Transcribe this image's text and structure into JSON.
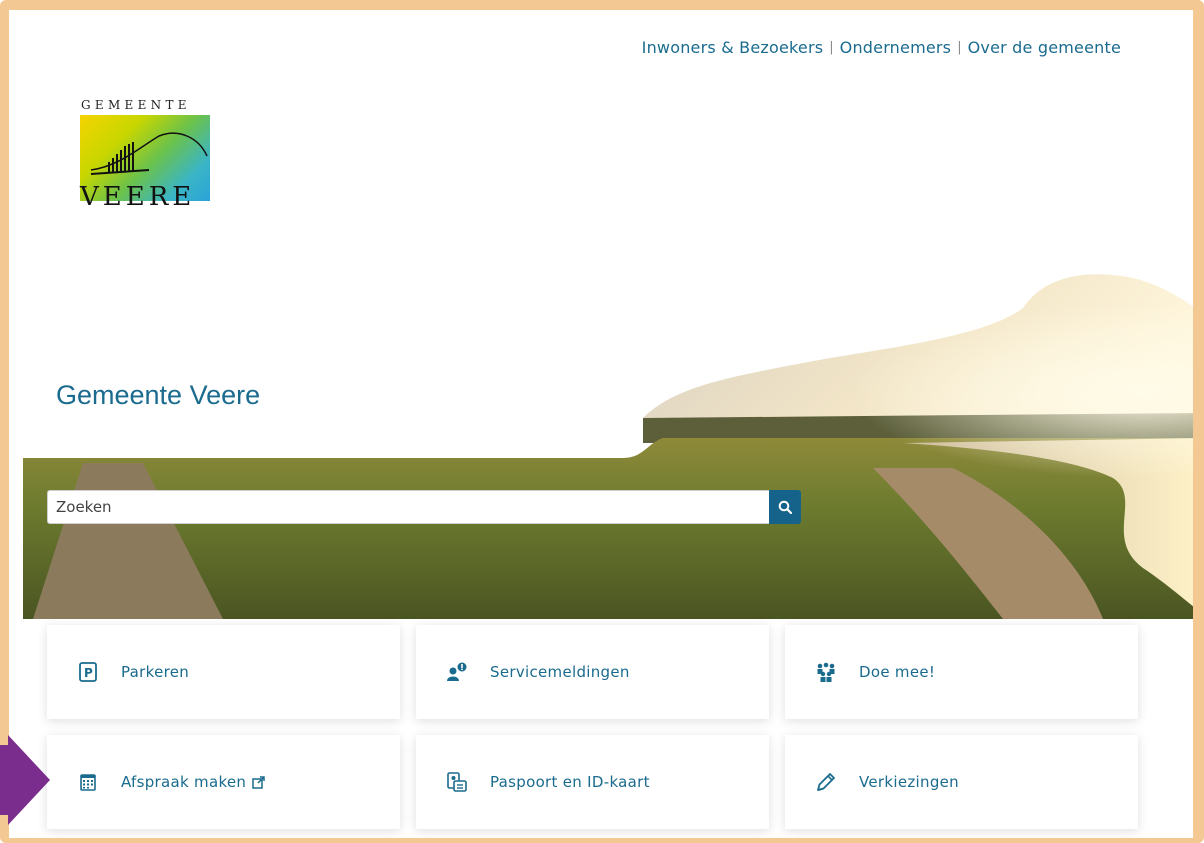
{
  "nav": {
    "links": [
      "Inwoners & Bezoekers",
      "Ondernemers",
      "Over de gemeente"
    ],
    "separator": "|"
  },
  "logo": {
    "top_text": "GEMEENTE",
    "bottom_text": "VEERE"
  },
  "page_title": "Gemeente Veere",
  "search": {
    "placeholder": "Zoeken",
    "button_icon": "search-icon"
  },
  "tiles": [
    {
      "label": "Parkeren",
      "icon": "parking-icon"
    },
    {
      "label": "Servicemeldingen",
      "icon": "service-report-icon"
    },
    {
      "label": "Doe mee!",
      "icon": "people-group-icon"
    },
    {
      "label": "Afspraak maken",
      "icon": "calendar-icon",
      "external": true
    },
    {
      "label": "Paspoort en ID-kaart",
      "icon": "id-card-icon"
    },
    {
      "label": "Verkiezingen",
      "icon": "pencil-icon"
    }
  ],
  "colors": {
    "accent": "#1a6b8e",
    "frame": "#f3c892",
    "arrow": "#7b2d8e",
    "search_button": "#15638a"
  }
}
